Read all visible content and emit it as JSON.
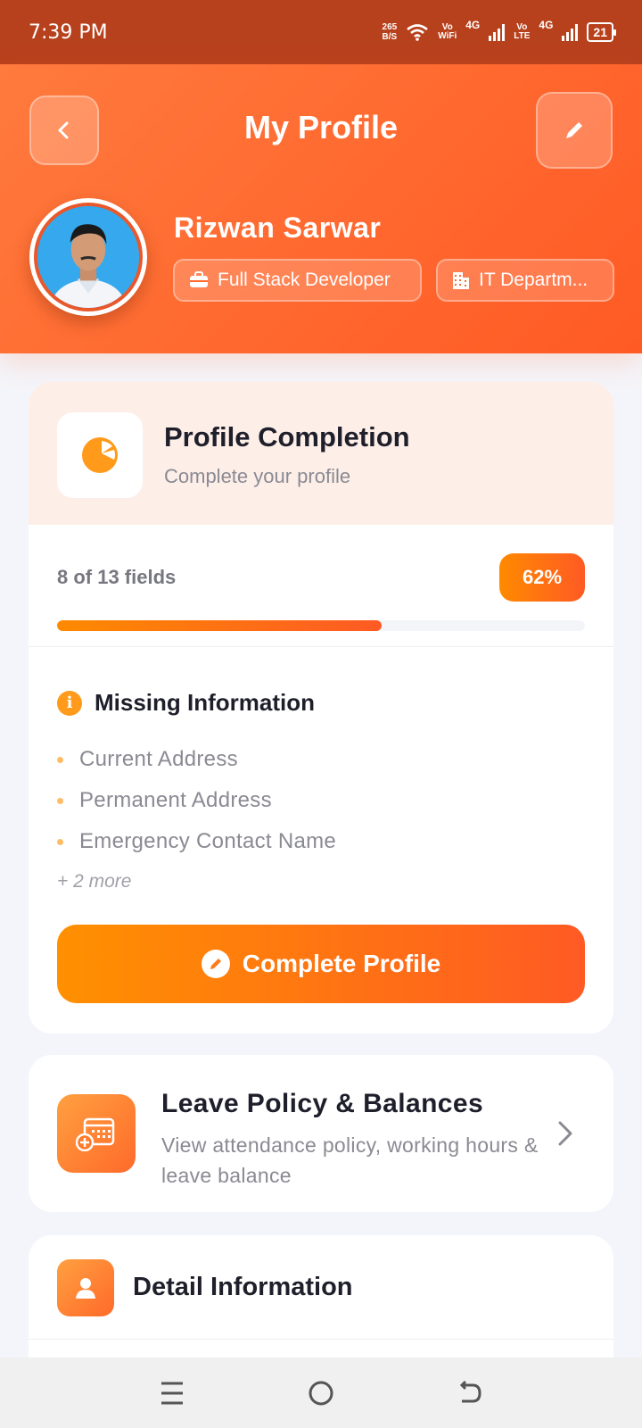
{
  "status_bar": {
    "time": "7:39 PM",
    "speed_value": "265",
    "speed_unit": "B/S",
    "vowifi_top": "Vo",
    "vowifi_bottom": "WiFi",
    "net1": "4G",
    "volte_top": "Vo",
    "volte_bottom": "LTE",
    "net2": "4G",
    "battery": "21"
  },
  "header": {
    "title": "My Profile",
    "back_icon": "chevron-left-icon",
    "edit_icon": "pencil-icon"
  },
  "profile": {
    "name": "Rizwan Sarwar",
    "role": "Full Stack Developer",
    "department": "IT Departm..."
  },
  "completion": {
    "title": "Profile Completion",
    "subtitle": "Complete your profile",
    "fields_text": "8 of 13 fields",
    "percent_label": "62%",
    "progress_fraction": 0.615,
    "missing_title": "Missing Information",
    "info_glyph": "i",
    "missing_items": [
      "Current Address",
      "Permanent Address",
      "Emergency Contact Name"
    ],
    "more_text": "+ 2 more",
    "button_label": "Complete Profile"
  },
  "leave": {
    "title": "Leave Policy & Balances",
    "subtitle": "View attendance policy, working hours & leave balance"
  },
  "detail": {
    "title": "Detail Information"
  },
  "colors": {
    "accent": "#ff5a24",
    "accent_light": "#ff9000",
    "status_bar": "#b8411d"
  }
}
